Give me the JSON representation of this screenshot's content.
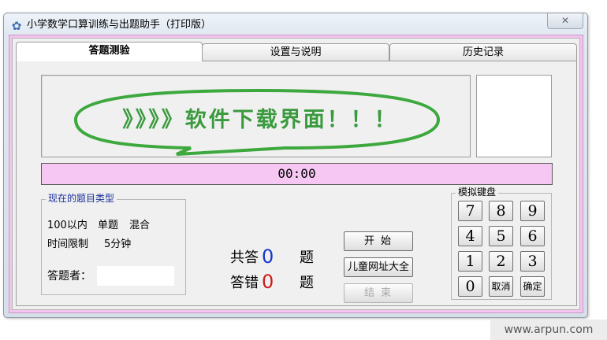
{
  "window": {
    "title": "小学数学口算训练与出题助手（打印版）"
  },
  "titlebar": {
    "close_glyph": "✕"
  },
  "tabs": [
    {
      "label": "答题测验"
    },
    {
      "label": "设置与说明"
    },
    {
      "label": "历史记录"
    }
  ],
  "quiz": {
    "banner": "》》》》软件下载界面！！！",
    "timer": "00:00",
    "type_group_title": "现在的题目类型",
    "type_range": "100以内",
    "type_mode": "单题",
    "type_op": "混合",
    "time_limit_label": "时间限制",
    "time_limit_value": "5分钟",
    "answerer_label": "答题者：",
    "answerer_value": "",
    "stats": {
      "total_label": "共答",
      "total_value": "0",
      "total_unit": "题",
      "wrong_label": "答错",
      "wrong_value": "0",
      "wrong_unit": "题"
    },
    "buttons": {
      "start": "开始",
      "links": "儿童网址大全",
      "end": "结束"
    }
  },
  "keyboard": {
    "title": "模拟键盘",
    "rows": [
      [
        "7",
        "8",
        "9"
      ],
      [
        "4",
        "5",
        "6"
      ],
      [
        "1",
        "2",
        "3"
      ],
      [
        "0",
        "取消",
        "确定"
      ]
    ]
  },
  "watermark": "www.arpun.com",
  "colors": {
    "frame_pink": "#f3c4ee",
    "timer_pink": "#f6c7f3",
    "banner_green": "#3a9a3e",
    "total_blue": "#1737c9",
    "wrong_red": "#d01a1a"
  }
}
